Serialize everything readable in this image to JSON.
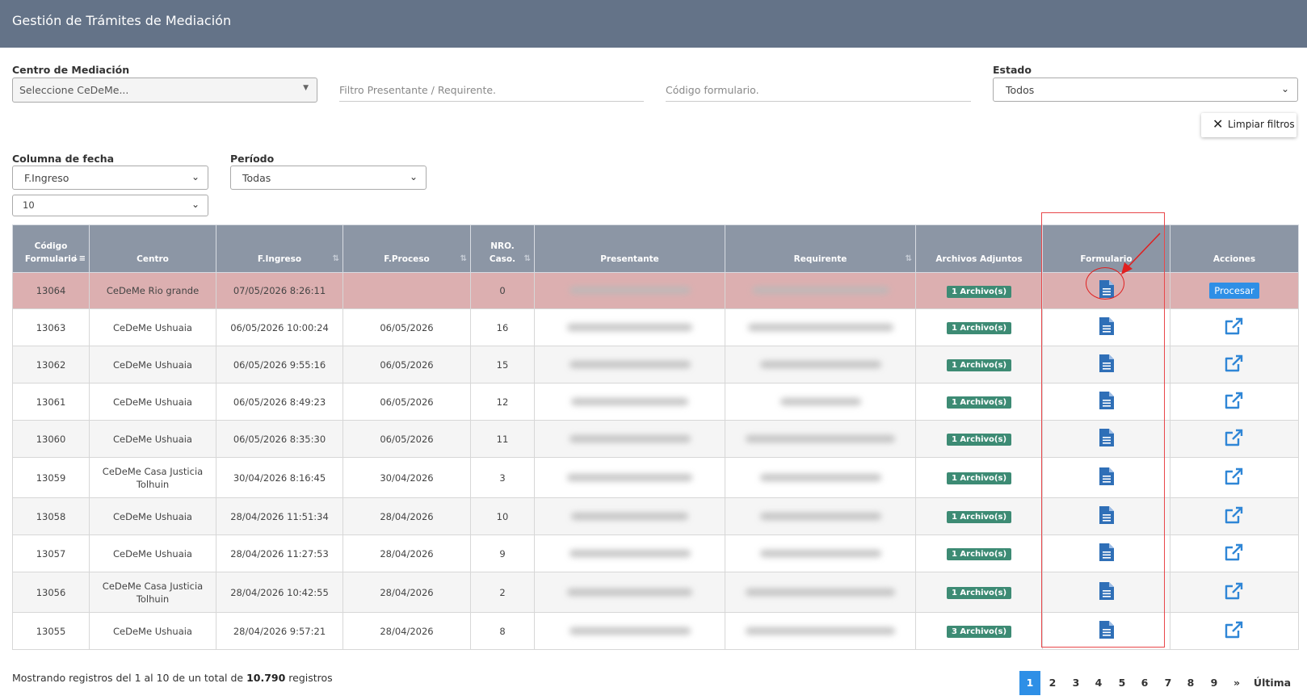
{
  "header": {
    "title": "Gestión de Trámites de Mediación"
  },
  "filters": {
    "centro_label": "Centro de Mediación",
    "centro_value": "Seleccione CeDeMe...",
    "presentante_placeholder": "Filtro Presentante / Requirente.",
    "codigo_placeholder": "Código formulario.",
    "estado_label": "Estado",
    "estado_value": "Todos",
    "clear_label": "Limpiar filtros",
    "fecha_label": "Columna de fecha",
    "fecha_value": "F.Ingreso",
    "periodo_label": "Período",
    "periodo_value": "Todas",
    "page_size_value": "10"
  },
  "table": {
    "headers": {
      "codigo_1": "Código",
      "codigo_2": "Formulario",
      "centro": "Centro",
      "ingreso": "F.Ingreso",
      "proceso": "F.Proceso",
      "nro_1": "NRO.",
      "nro_2": "Caso.",
      "presentante": "Presentante",
      "requirente": "Requirente",
      "archivos": "Archivos Adjuntos",
      "formulario": "Formulario",
      "acciones": "Acciones"
    },
    "process_label": "Procesar",
    "rows": [
      {
        "codigo": "13064",
        "centro": "CeDeMe Rio grande",
        "ingreso": "07/05/2026 8:26:11",
        "proceso": "",
        "nro": "0",
        "archivos": "1 Archivo(s)"
      },
      {
        "codigo": "13063",
        "centro": "CeDeMe Ushuaia",
        "ingreso": "06/05/2026 10:00:24",
        "proceso": "06/05/2026",
        "nro": "16",
        "archivos": "1 Archivo(s)"
      },
      {
        "codigo": "13062",
        "centro": "CeDeMe Ushuaia",
        "ingreso": "06/05/2026 9:55:16",
        "proceso": "06/05/2026",
        "nro": "15",
        "archivos": "1 Archivo(s)"
      },
      {
        "codigo": "13061",
        "centro": "CeDeMe Ushuaia",
        "ingreso": "06/05/2026 8:49:23",
        "proceso": "06/05/2026",
        "nro": "12",
        "archivos": "1 Archivo(s)"
      },
      {
        "codigo": "13060",
        "centro": "CeDeMe Ushuaia",
        "ingreso": "06/05/2026 8:35:30",
        "proceso": "06/05/2026",
        "nro": "11",
        "archivos": "1 Archivo(s)"
      },
      {
        "codigo": "13059",
        "centro": "CeDeMe Casa Justicia Tolhuin",
        "ingreso": "30/04/2026 8:16:45",
        "proceso": "30/04/2026",
        "nro": "3",
        "archivos": "1 Archivo(s)"
      },
      {
        "codigo": "13058",
        "centro": "CeDeMe Ushuaia",
        "ingreso": "28/04/2026 11:51:34",
        "proceso": "28/04/2026",
        "nro": "10",
        "archivos": "1 Archivo(s)"
      },
      {
        "codigo": "13057",
        "centro": "CeDeMe Ushuaia",
        "ingreso": "28/04/2026 11:27:53",
        "proceso": "28/04/2026",
        "nro": "9",
        "archivos": "1 Archivo(s)"
      },
      {
        "codigo": "13056",
        "centro": "CeDeMe Casa Justicia Tolhuin",
        "ingreso": "28/04/2026 10:42:55",
        "proceso": "28/04/2026",
        "nro": "2",
        "archivos": "1 Archivo(s)"
      },
      {
        "codigo": "13055",
        "centro": "CeDeMe Ushuaia",
        "ingreso": "28/04/2026 9:57:21",
        "proceso": "28/04/2026",
        "nro": "8",
        "archivos": "3 Archivo(s)"
      }
    ]
  },
  "footer": {
    "summary_prefix": "Mostrando registros del 1 al 10 de un total de ",
    "total": "10.790",
    "summary_suffix": " registros"
  },
  "pagination": {
    "pages": [
      "1",
      "2",
      "3",
      "4",
      "5",
      "6",
      "7",
      "8",
      "9"
    ],
    "next": "»",
    "last": "Última"
  },
  "colors": {
    "header_bar": "#647388",
    "table_header": "#8c96a5",
    "highlight_row": "#dcafb0",
    "badge": "#3d8b74",
    "accent": "#2e8fe6",
    "annotation": "#e8474a"
  },
  "icons": {
    "formulario": "document-icon",
    "acciones": "external-link-icon"
  }
}
